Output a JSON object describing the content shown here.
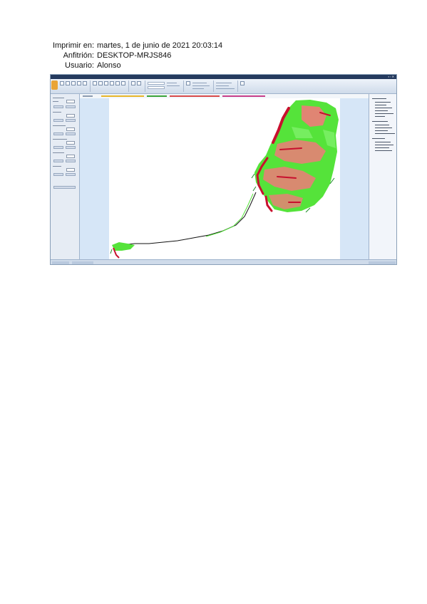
{
  "print_info": {
    "printed_label": "Imprimir en:",
    "printed_value": "martes, 1 de junio de 2021 20:03:14",
    "host_label": "Anfitrión:",
    "host_value": "DESKTOP-MRJS846",
    "user_label": "Usuario:",
    "user_value": "Alonso"
  },
  "screenshot": {
    "map_colors": {
      "green": "#55e33a",
      "pink": "#f07a7a",
      "red": "#c8102e",
      "dark_green": "#1f8a2a"
    }
  }
}
